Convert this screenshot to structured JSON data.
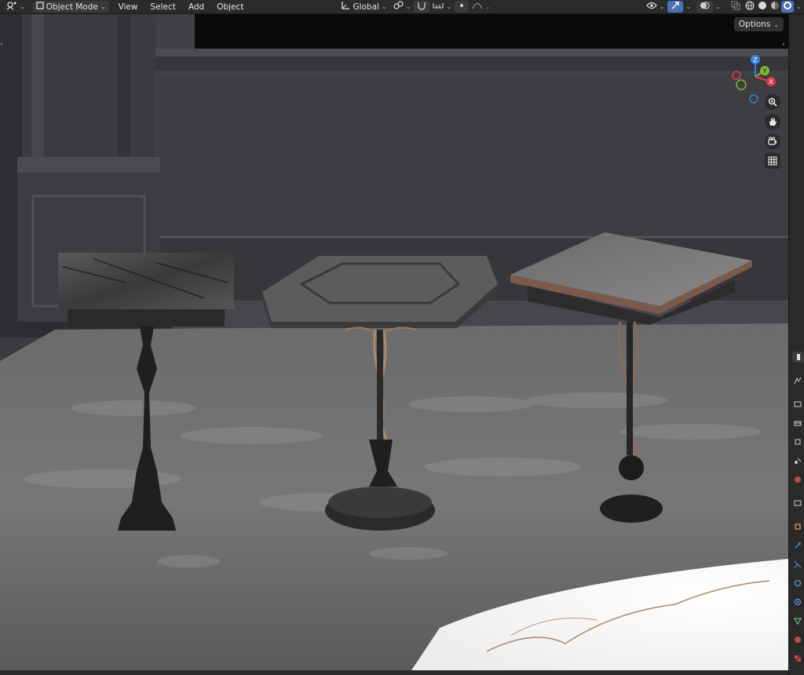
{
  "header": {
    "editor_type_icon": "camera-orbit-icon",
    "mode": "Object Mode",
    "menus": [
      "View",
      "Select",
      "Add",
      "Object"
    ],
    "transform_orientation": "Global",
    "options_label": "Options"
  },
  "gizmo": {
    "z": "Z",
    "y": "Y",
    "x": "X"
  },
  "colors": {
    "accent": "#4772b3",
    "x_axis": "#e0394b",
    "y_axis": "#7cb82f",
    "z_axis": "#3a7fd9",
    "header_bg": "#2b2b2b"
  },
  "navtools": [
    "zoom-icon",
    "pan-hand-icon",
    "camera-icon",
    "grid-icon"
  ],
  "properties_tabs": [
    "tool-icon",
    "render-icon",
    "output-icon",
    "view-layer-icon",
    "scene-icon",
    "world-icon",
    "collection-icon",
    "object-icon",
    "modifier-icon",
    "particles-icon",
    "physics-icon",
    "constraints-icon",
    "data-icon",
    "material-icon",
    "texture-icon"
  ]
}
